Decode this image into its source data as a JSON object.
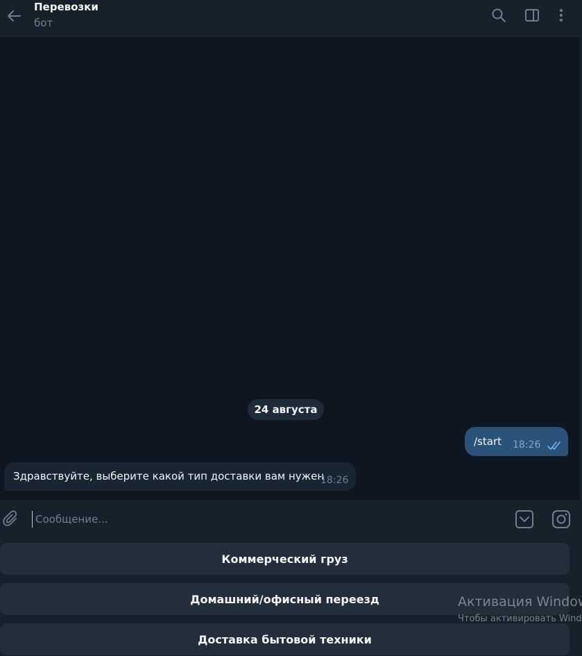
{
  "header": {
    "title": "Перевозки",
    "subtitle": "бот",
    "icons": [
      "back-arrow-icon",
      "search-icon",
      "sidebar-toggle-icon",
      "more-vertical-icon"
    ]
  },
  "messages": {
    "date_badge": "24 августа",
    "outgoing": {
      "text": "/start",
      "time": "18:26",
      "status": "read"
    },
    "incoming": {
      "text": "Здравствуйте, выберите какой тип доставки вам нужен",
      "time": "18:26"
    }
  },
  "composer": {
    "placeholder": "Сообщение...",
    "value": "",
    "icons": [
      "paperclip-icon",
      "bot-keyboard-icon",
      "camera-icon"
    ]
  },
  "bot_keyboard": {
    "buttons": [
      "Коммерческий груз",
      "Домашний/офисный переезд",
      "Доставка бытовой техники"
    ]
  },
  "watermark": {
    "line1": "Активация Windows",
    "line2": "Чтобы активировать Windows"
  },
  "colors": {
    "background": "#0e1621",
    "panel": "#17212b",
    "outgoing_bubble": "#2b5278",
    "incoming_bubble": "#182533",
    "keyboard_button": "#232e3c",
    "accent": "#6ab2f2"
  }
}
